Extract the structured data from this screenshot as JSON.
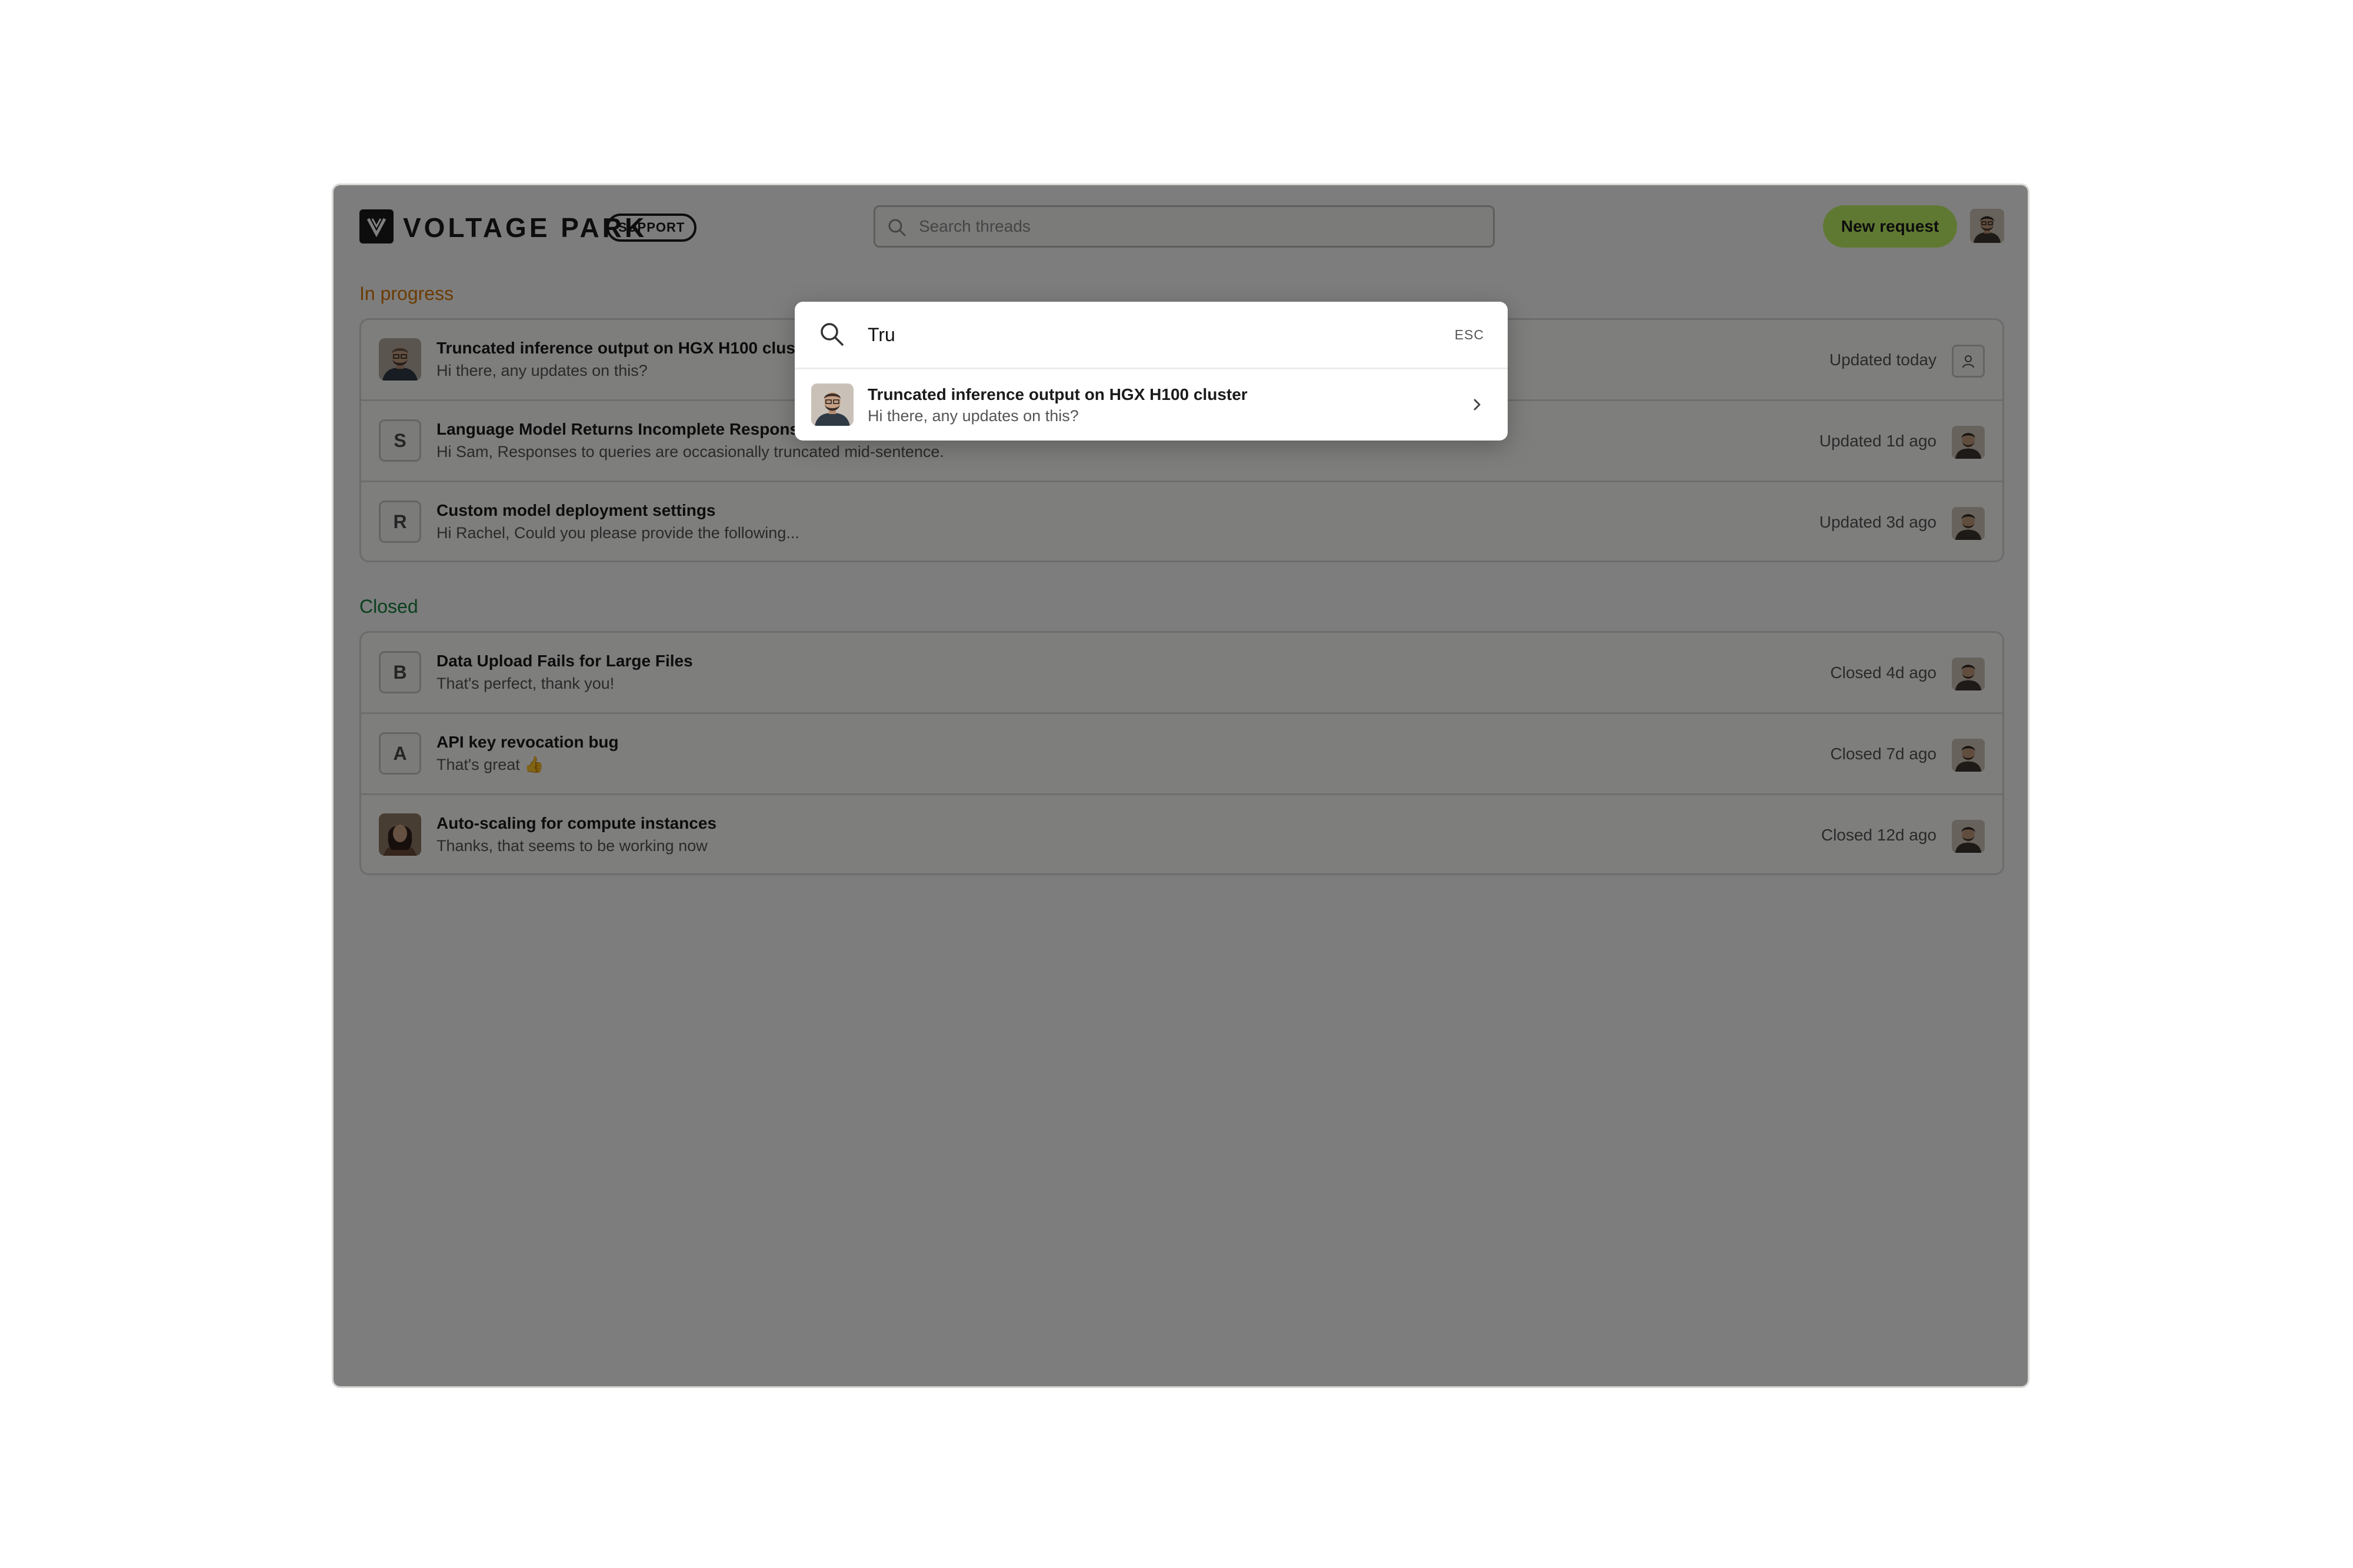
{
  "header": {
    "brand_name": "VOLTAGE PARK",
    "badge": "SUPPORT",
    "search_placeholder": "Search threads",
    "new_request_label": "New request",
    "accent_color": "#c1f364"
  },
  "sections": {
    "in_progress": {
      "title": "In progress",
      "color": "#d97706",
      "threads": [
        {
          "avatar": "photo",
          "title": "Truncated inference output on HGX H100 cluster",
          "preview": "Hi there, any updates on this?",
          "status": "Updated today",
          "assignee": "unassigned-user-icon"
        },
        {
          "avatar": "S",
          "title": "Language Model Returns Incomplete Responses",
          "preview": "Hi Sam, Responses to queries are occasionally truncated mid-sentence.",
          "status": "Updated 1d ago",
          "assignee": "photo"
        },
        {
          "avatar": "R",
          "title": "Custom model deployment settings",
          "preview": "Hi Rachel, Could you please provide the following...",
          "status": "Updated 3d ago",
          "assignee": "photo"
        }
      ]
    },
    "closed": {
      "title": "Closed",
      "color": "#15803d",
      "threads": [
        {
          "avatar": "B",
          "title": "Data Upload Fails for Large Files",
          "preview": "That's perfect, thank you!",
          "status": "Closed 4d ago",
          "assignee": "photo"
        },
        {
          "avatar": "A",
          "title": "API key revocation bug",
          "preview": "That's great 👍",
          "status": "Closed 7d ago",
          "assignee": "photo"
        },
        {
          "avatar": "photo",
          "title": "Auto-scaling for compute instances",
          "preview": "Thanks, that seems to be working now",
          "status": "Closed 12d ago",
          "assignee": "photo"
        }
      ]
    }
  },
  "search_modal": {
    "query": "Tru",
    "esc_hint": "ESC",
    "results": [
      {
        "title": "Truncated inference output on HGX H100 cluster",
        "preview": "Hi there, any updates on this?"
      }
    ]
  }
}
